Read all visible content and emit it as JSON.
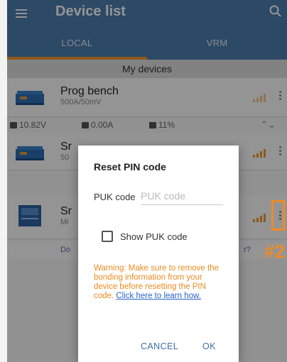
{
  "appbar": {
    "title": "Device list",
    "bg_color": "#4c7fb0",
    "accent_color": "#f29a31",
    "menu_icon": "hamburger-menu-icon",
    "search_icon": "search-icon"
  },
  "tabs": [
    {
      "label": "LOCAL",
      "active": true
    },
    {
      "label": "VRM",
      "active": false
    }
  ],
  "section": {
    "title": "My devices"
  },
  "devices": [
    {
      "name": "Prog bench",
      "sub": "500A/50mV"
    },
    {
      "name": "Sr",
      "sub": "50"
    },
    {
      "name": "Sr",
      "sub": "Mi"
    }
  ],
  "stats": {
    "voltage": "10.82V",
    "current": "0.00A",
    "soc": "11%"
  },
  "hint": {
    "left": "Do",
    "right": "r?"
  },
  "dialog": {
    "title": "Reset PIN code",
    "puk_label": "PUK code",
    "puk_placeholder": "PUK code",
    "puk_value": "",
    "show_puk_label": "Show PUK code",
    "show_puk_checked": false,
    "warning_text": "Warning: Make sure to remove the bonding information from your device before resetting the PIN code.",
    "warning_link": "Click here to learn how.",
    "cancel_label": "CANCEL",
    "ok_label": "OK"
  },
  "annotation": {
    "marker": "#2",
    "color": "#f08a24"
  }
}
